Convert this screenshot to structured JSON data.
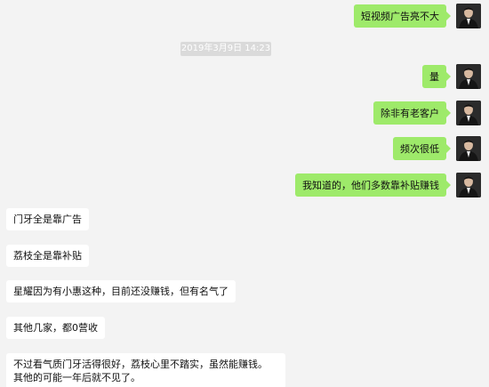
{
  "conversation": {
    "timestamp": "2019年3月9日 14:23",
    "outgoing": [
      {
        "text": "短视频广告亮不大"
      },
      {
        "text": "量"
      },
      {
        "text": "除非有老客户"
      },
      {
        "text": "频次很低"
      },
      {
        "text": "我知道的，他们多数靠补贴赚钱"
      }
    ],
    "incoming": [
      {
        "text": "门牙全是靠广告"
      },
      {
        "text": "荔枝全是靠补贴"
      },
      {
        "text": "星耀因为有小惠这种，目前还没赚钱，但有名气了"
      },
      {
        "text": "其他几家，都0营收"
      },
      {
        "lines": [
          "不过看气质门牙活得很好，荔枝心里不踏实，虽然能赚钱。",
          "其他的可能一年后就不见了。"
        ]
      }
    ]
  },
  "avatar_icon": "person-avatar-icon",
  "colors": {
    "background": "#f3f3f3",
    "outgoing_bubble": "#9eea6a",
    "incoming_bubble": "#ffffff",
    "timestamp_bg": "#dadada"
  }
}
